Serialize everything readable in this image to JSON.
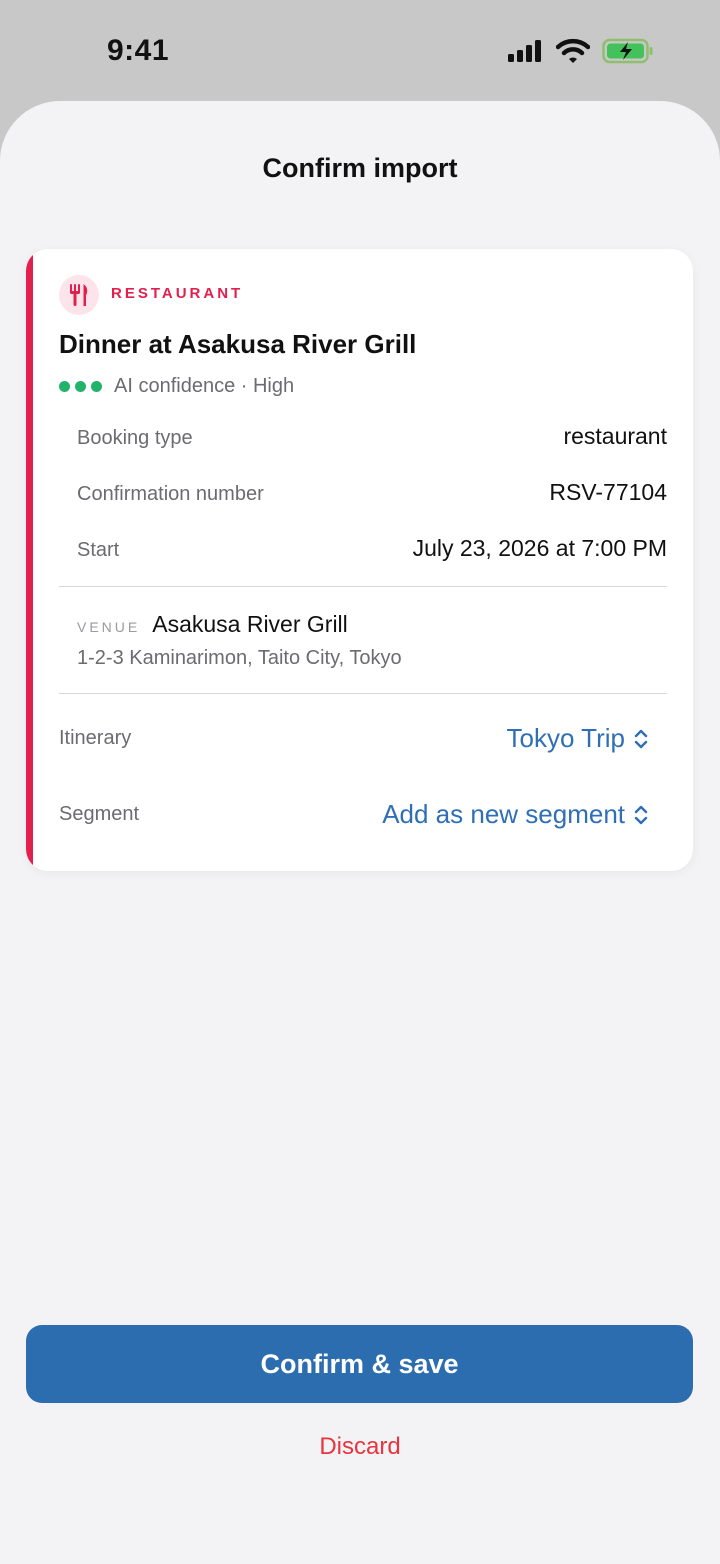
{
  "status_bar": {
    "time": "9:41"
  },
  "sheet": {
    "title": "Confirm import"
  },
  "card": {
    "category": "RESTAURANT",
    "category_icon": "fork-knife-icon",
    "accent_color": "#e3204d",
    "title": "Dinner at Asakusa River Grill",
    "confidence_text": "AI confidence · High",
    "confidence_color": "#21b36b",
    "details": [
      {
        "label": "Booking type",
        "value": "restaurant"
      },
      {
        "label": "Confirmation number",
        "value": "RSV-77104"
      },
      {
        "label": "Start",
        "value": "July 23, 2026 at 7:00 PM"
      }
    ],
    "venue": {
      "tag": "VENUE",
      "name": "Asakusa River Grill",
      "address": "1-2-3 Kaminarimon, Taito City, Tokyo"
    },
    "itinerary": {
      "label": "Itinerary",
      "value": "Tokyo Trip"
    },
    "segment": {
      "label": "Segment",
      "value": "Add as new segment"
    }
  },
  "actions": {
    "confirm_label": "Confirm & save",
    "discard_label": "Discard",
    "primary_color": "#2c6db0",
    "danger_color": "#e8343f"
  }
}
